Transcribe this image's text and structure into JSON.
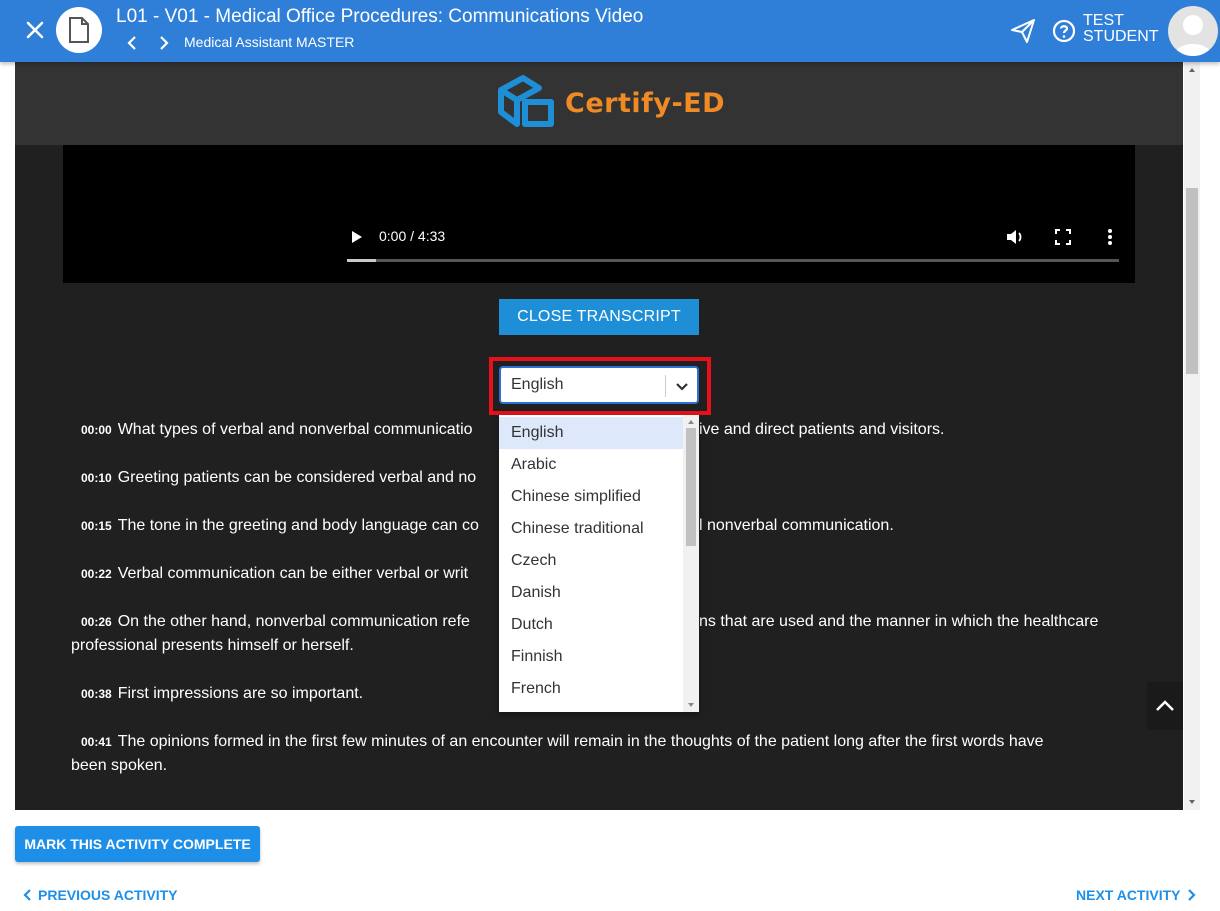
{
  "header": {
    "title": "L01 - V01 - Medical Office Procedures: Communications Video",
    "subtitle": "Medical Assistant MASTER",
    "user_line1": "TEST",
    "user_line2": "STUDENT",
    "icons": [
      "close-icon",
      "document-icon",
      "chevron-left-icon",
      "chevron-right-icon",
      "send-icon",
      "help-icon",
      "avatar"
    ]
  },
  "brand": {
    "name": "Certify-ED"
  },
  "video": {
    "time": "0:00 / 4:33",
    "progress_fraction": 0.037
  },
  "transcript_button": "CLOSE TRANSCRIPT",
  "language_select": {
    "value": "English",
    "options": [
      "English",
      "Arabic",
      "Chinese simplified",
      "Chinese traditional",
      "Czech",
      "Danish",
      "Dutch",
      "Finnish",
      "French"
    ]
  },
  "transcript": [
    {
      "ts": "00:00",
      "text_before": "What types of verbal and nonverbal communicatio",
      "text_after": "ive and direct patients and visitors."
    },
    {
      "ts": "00:10",
      "text_before": "Greeting patients can be considered verbal and no",
      "text_after": ""
    },
    {
      "ts": "00:15",
      "text_before": "The tone in the greeting and body language can co",
      "text_after": "l nonverbal communication."
    },
    {
      "ts": "00:22",
      "text_before": "Verbal communication can be either verbal or writ",
      "text_after": ""
    },
    {
      "ts": "00:26",
      "text_before": "On the other hand, nonverbal communication refe",
      "text_after": "ns that are used and the manner in which the healthcare",
      "line2": "professional presents himself or herself."
    },
    {
      "ts": "00:38",
      "text_before": "First impressions are so important.",
      "text_after": ""
    },
    {
      "ts": "00:41",
      "text_before": "The opinions formed in the first few minutes of an encounter will remain in the thoughts of the patient long after the first words have",
      "text_after": "",
      "line2": "been spoken."
    }
  ],
  "footer": {
    "mark_complete": "MARK THIS ACTIVITY COMPLETE",
    "previous": "PREVIOUS ACTIVITY",
    "next": "NEXT ACTIVITY"
  }
}
